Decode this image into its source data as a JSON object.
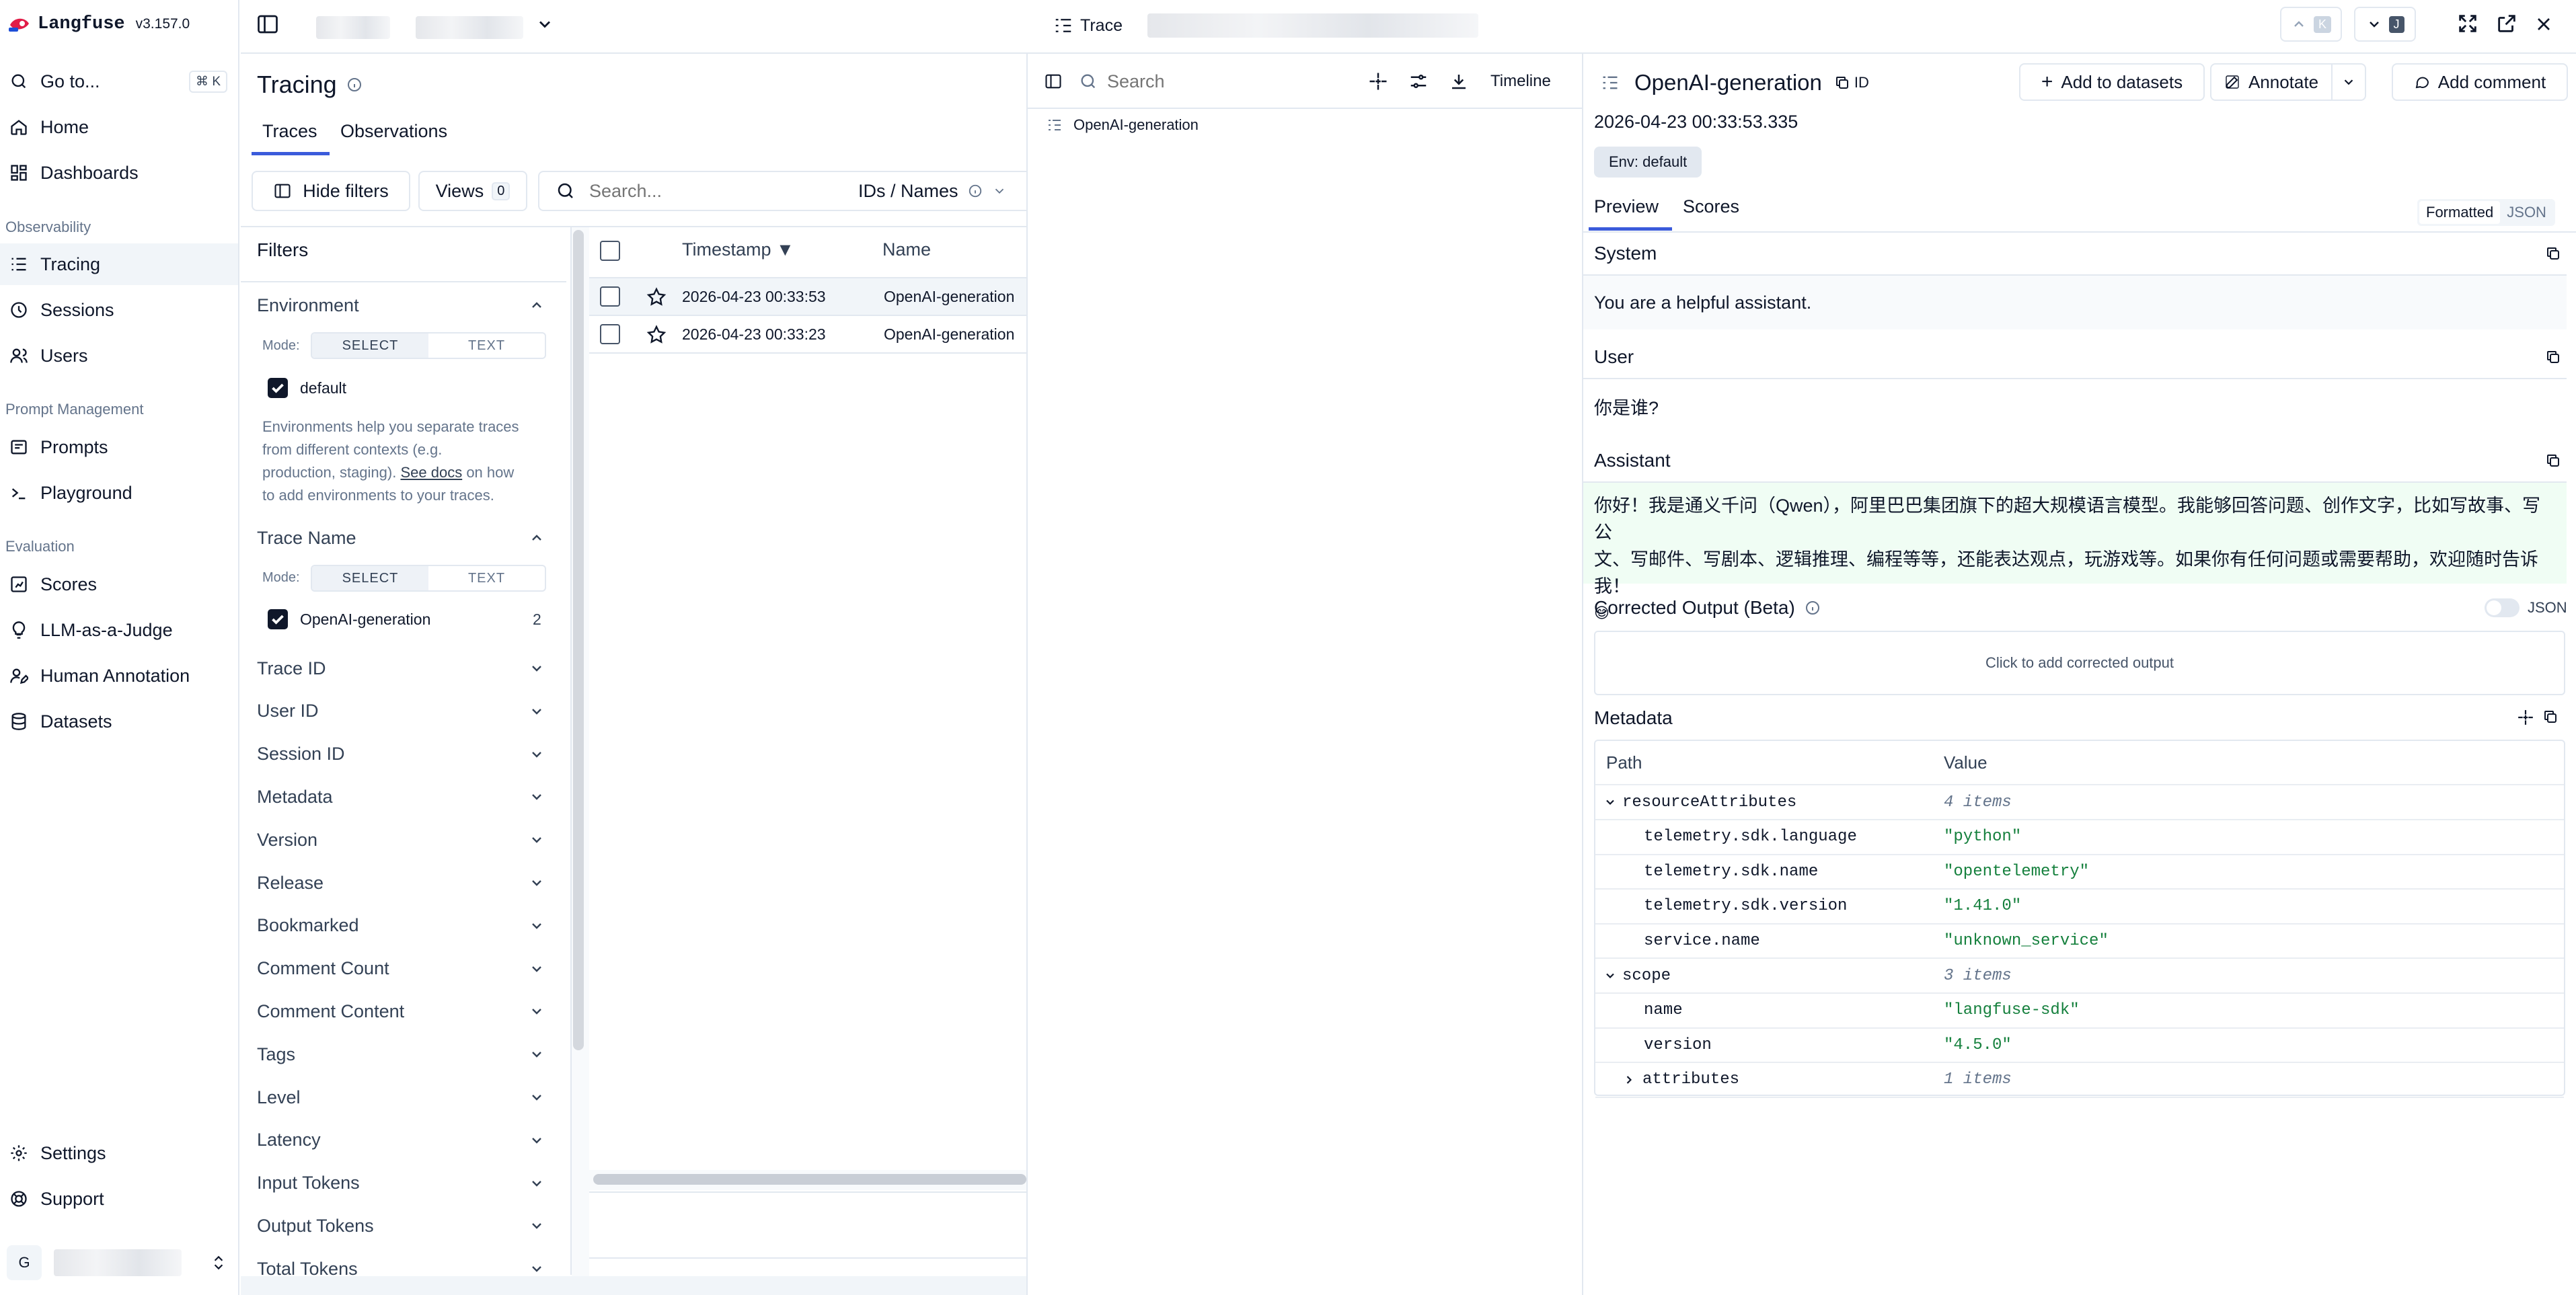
{
  "app": {
    "name": "Langfuse",
    "version": "v3.157.0"
  },
  "sidebar": {
    "goto": {
      "label": "Go to...",
      "shortcut": "⌘ K"
    },
    "top_items": [
      {
        "label": "Home",
        "icon": "home-icon"
      },
      {
        "label": "Dashboards",
        "icon": "dashboard-icon"
      }
    ],
    "sections": [
      {
        "title": "Observability",
        "items": [
          {
            "label": "Tracing",
            "icon": "tracing-icon",
            "active": true
          },
          {
            "label": "Sessions",
            "icon": "sessions-icon"
          },
          {
            "label": "Users",
            "icon": "users-icon"
          }
        ]
      },
      {
        "title": "Prompt Management",
        "items": [
          {
            "label": "Prompts",
            "icon": "prompts-icon"
          },
          {
            "label": "Playground",
            "icon": "playground-icon"
          }
        ]
      },
      {
        "title": "Evaluation",
        "items": [
          {
            "label": "Scores",
            "icon": "scores-icon"
          },
          {
            "label": "LLM-as-a-Judge",
            "icon": "lightbulb-icon"
          },
          {
            "label": "Human Annotation",
            "icon": "annotation-icon"
          },
          {
            "label": "Datasets",
            "icon": "database-icon"
          }
        ]
      }
    ],
    "bottom_items": [
      {
        "label": "Settings",
        "icon": "gear-icon"
      },
      {
        "label": "Support",
        "icon": "support-icon"
      }
    ],
    "user_initial": "G"
  },
  "tracing": {
    "title": "Tracing",
    "tabs": [
      "Traces",
      "Observations"
    ],
    "hide_filters_label": "Hide filters",
    "views_label": "Views",
    "views_count": "0",
    "search_placeholder": "Search...",
    "search_mode": "IDs / Names",
    "filters": {
      "title": "Filters",
      "environment": {
        "title": "Environment",
        "mode_label": "Mode:",
        "mode_select": "SELECT",
        "mode_text": "TEXT",
        "option": "default",
        "help_line1": "Environments help you separate traces",
        "help_line2": "from different contexts (e.g.",
        "help_line3_pre": "production, staging). ",
        "help_link": "See docs",
        "help_line3_post": " on how",
        "help_line4": "to add environments to your traces."
      },
      "trace_name": {
        "title": "Trace Name",
        "mode_label": "Mode:",
        "mode_select": "SELECT",
        "mode_text": "TEXT",
        "option": "OpenAI-generation",
        "count": "2"
      },
      "collapsed": [
        "Trace ID",
        "User ID",
        "Session ID",
        "Metadata",
        "Version",
        "Release",
        "Bookmarked",
        "Comment Count",
        "Comment Content",
        "Tags",
        "Level",
        "Latency",
        "Input Tokens",
        "Output Tokens",
        "Total Tokens"
      ]
    },
    "table": {
      "col_timestamp": "Timestamp ▼",
      "col_name": "Name",
      "rows": [
        {
          "timestamp": "2026-04-23 00:33:53",
          "name": "OpenAI-generation"
        },
        {
          "timestamp": "2026-04-23 00:33:23",
          "name": "OpenAI-generation"
        }
      ]
    }
  },
  "trace_panel": {
    "tab_label": "Trace",
    "search_placeholder": "Search",
    "timeline_label": "Timeline",
    "tree_item": "OpenAI-generation",
    "nav_up_key": "K",
    "nav_down_key": "J"
  },
  "detail": {
    "title": "OpenAI-generation",
    "id_label": "ID",
    "add_to_datasets": "Add to datasets",
    "annotate": "Annotate",
    "add_comment": "Add comment",
    "timestamp": "2026-04-23 00:33:53.335",
    "env_badge": "Env: default",
    "tabs": [
      "Preview",
      "Scores"
    ],
    "view_formatted": "Formatted",
    "view_json": "JSON",
    "system_title": "System",
    "system_text": "You are a helpful assistant.",
    "user_title": "User",
    "user_text": "你是谁?",
    "assistant_title": "Assistant",
    "assistant_line1": "你好！我是通义千问（Qwen），阿里巴巴集团旗下的超大规模语言模型。我能够回答问题、创作文字，比如写故事、写公",
    "assistant_line2": "文、写邮件、写剧本、逻辑推理、编程等等，还能表达观点，玩游戏等。如果你有任何问题或需要帮助，欢迎随时告诉我！",
    "assistant_emoji": "😊",
    "corrected_title": "Corrected Output (Beta)",
    "corrected_json": "JSON",
    "corrected_placeholder": "Click to add corrected output",
    "metadata_title": "Metadata",
    "metadata_col_path": "Path",
    "metadata_col_value": "Value",
    "metadata_rows": [
      {
        "path": "resourceAttributes",
        "value": "4 items",
        "kind": "group",
        "expanded": true,
        "level": 0
      },
      {
        "path": "telemetry.sdk.language",
        "value": "\"python\"",
        "kind": "str",
        "level": 1
      },
      {
        "path": "telemetry.sdk.name",
        "value": "\"opentelemetry\"",
        "kind": "str",
        "level": 1
      },
      {
        "path": "telemetry.sdk.version",
        "value": "\"1.41.0\"",
        "kind": "str",
        "level": 1
      },
      {
        "path": "service.name",
        "value": "\"unknown_service\"",
        "kind": "str",
        "level": 1
      },
      {
        "path": "scope",
        "value": "3 items",
        "kind": "group",
        "expanded": true,
        "level": 0
      },
      {
        "path": "name",
        "value": "\"langfuse-sdk\"",
        "kind": "str",
        "level": 1
      },
      {
        "path": "version",
        "value": "\"4.5.0\"",
        "kind": "str",
        "level": 1
      },
      {
        "path": "attributes",
        "value": "1 items",
        "kind": "group",
        "expanded": false,
        "level": 1
      }
    ]
  }
}
